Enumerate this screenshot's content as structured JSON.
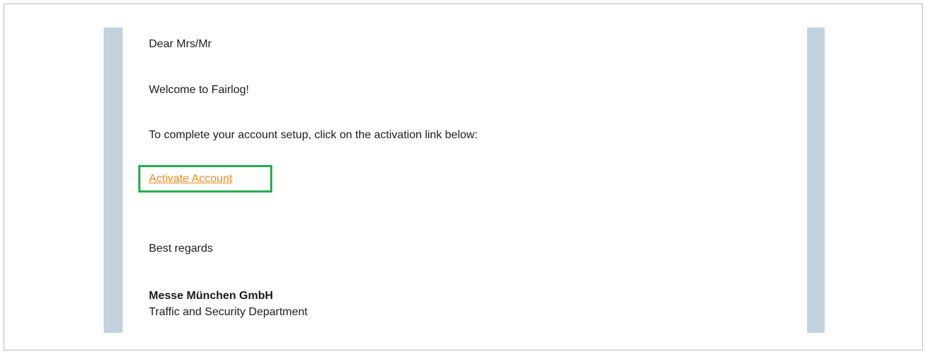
{
  "email": {
    "greeting": "Dear Mrs/Mr",
    "welcome": "Welcome to Fairlog!",
    "instruction": "To complete your account setup, click on the activation link below:",
    "activation_link": "Activate Account",
    "closing": "Best regards",
    "company": "Messe München GmbH",
    "department": "Traffic and Security Department"
  },
  "colors": {
    "band": "#c3d3de",
    "link": "#f08a1c",
    "highlight": "#22b04b"
  }
}
